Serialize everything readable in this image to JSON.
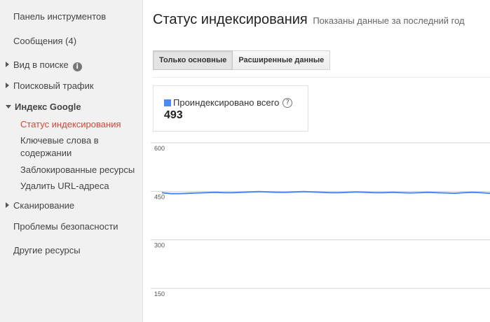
{
  "sidebar": {
    "items": [
      {
        "label": "Панель инструментов"
      },
      {
        "label": "Сообщения (4)"
      },
      {
        "label": "Вид в поиске"
      },
      {
        "label": "Поисковый трафик"
      },
      {
        "label": "Индекс Google"
      },
      {
        "label": "Сканирование"
      },
      {
        "label": "Проблемы безопасности"
      },
      {
        "label": "Другие ресурсы"
      }
    ],
    "info_glyph": "i",
    "index_subitems": [
      {
        "label": "Статус индексирования"
      },
      {
        "label": "Ключевые слова в содержании"
      },
      {
        "label": "Заблокированные ресурсы"
      },
      {
        "label": "Удалить URL-адреса"
      }
    ]
  },
  "main": {
    "title": "Статус индексирования",
    "subtitle": "Показаны данные за последний год",
    "tabs": [
      {
        "label": "Только основные",
        "selected": true
      },
      {
        "label": "Расширенные данные",
        "selected": false
      }
    ],
    "stat": {
      "legend_label": "Проиндексировано всего",
      "help_glyph": "?",
      "value": "493"
    }
  },
  "colors": {
    "accent_active": "#d14836",
    "series": "#4a8af4"
  },
  "chart_data": {
    "type": "line",
    "yticks": [
      600,
      450,
      300,
      150
    ],
    "ylim": [
      150,
      600
    ],
    "series": [
      {
        "values": [
          446,
          443,
          443,
          444,
          445,
          446,
          447,
          446,
          446,
          447,
          448,
          449,
          448,
          447,
          447,
          448,
          449,
          448,
          447,
          446,
          446,
          447,
          448,
          447,
          446,
          446,
          447,
          446,
          445,
          446,
          447,
          446,
          445,
          444,
          446,
          447,
          446,
          444
        ]
      }
    ]
  }
}
